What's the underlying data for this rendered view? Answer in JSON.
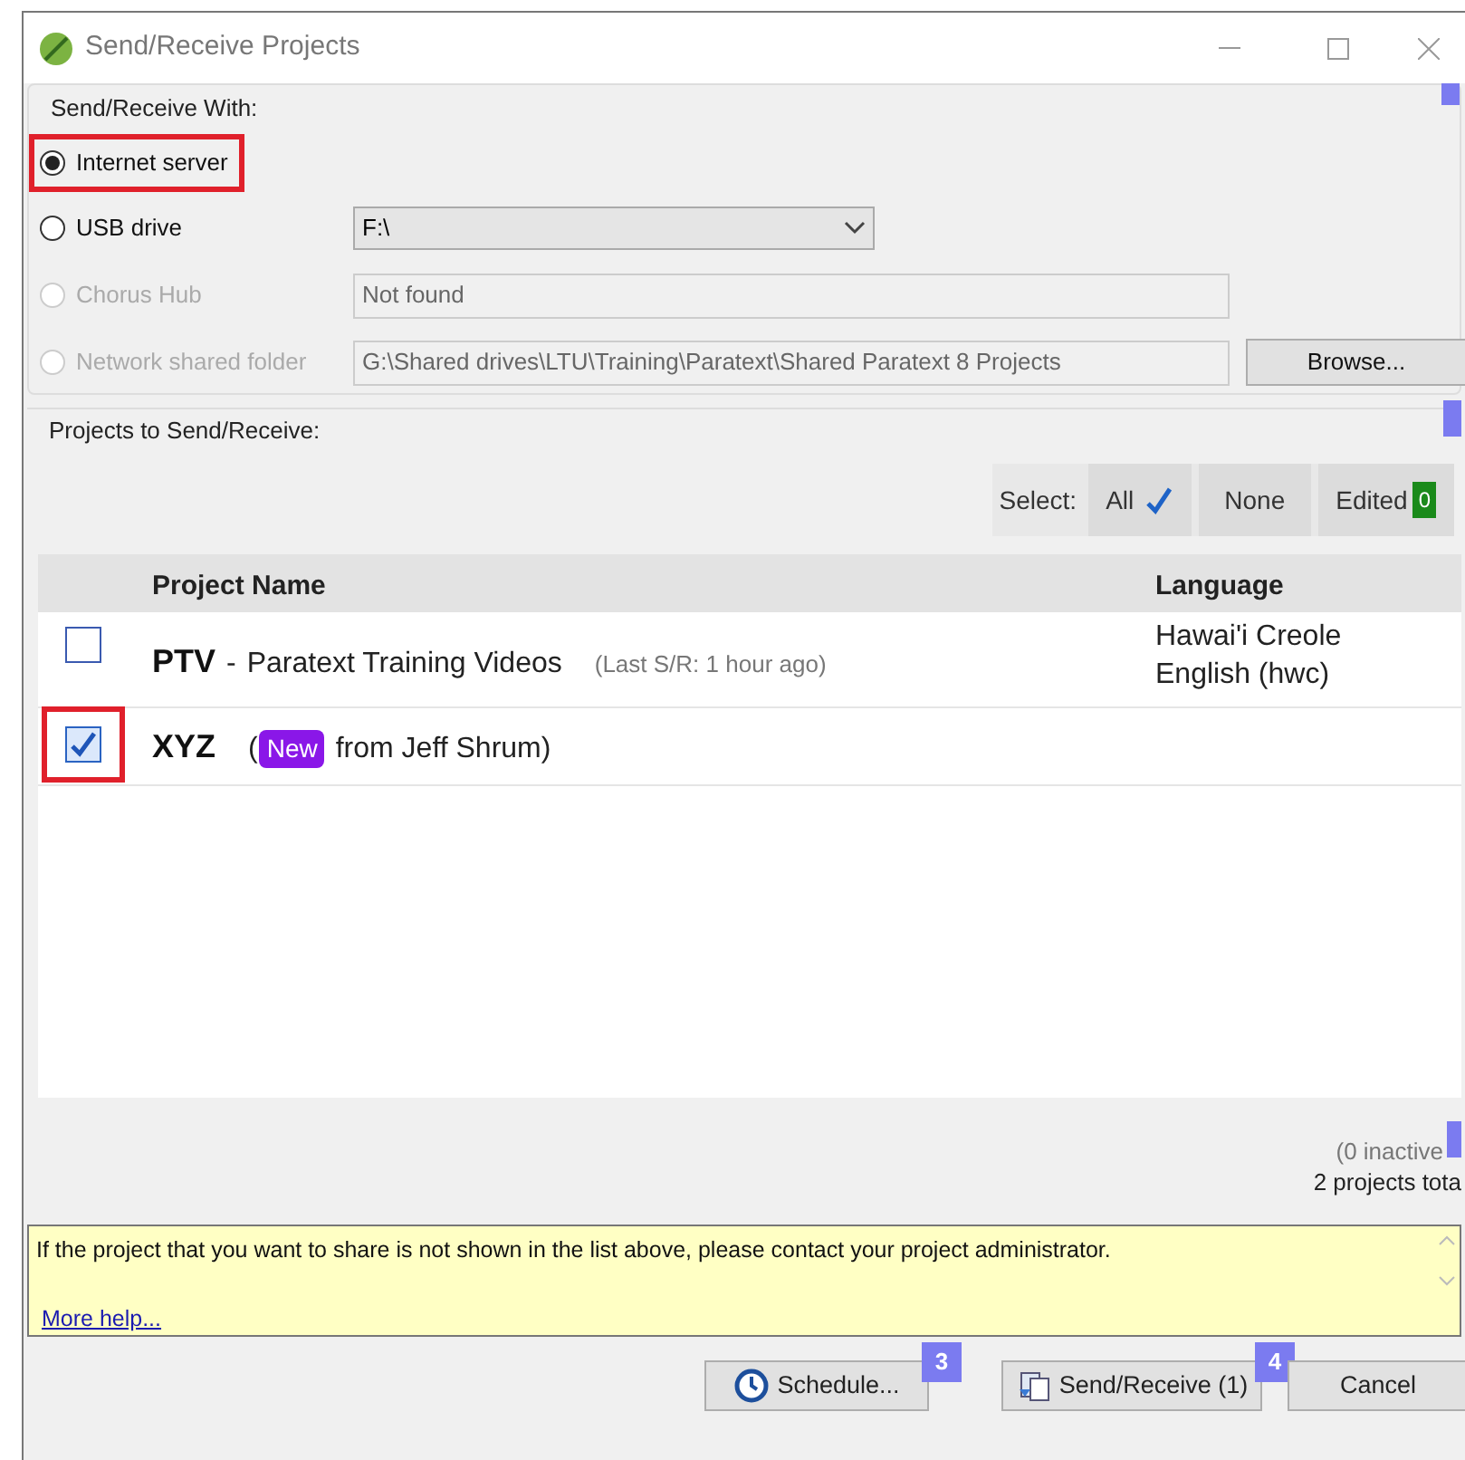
{
  "window": {
    "title": "Send/Receive Projects"
  },
  "send_receive_with": {
    "title": "Send/Receive With:",
    "options": [
      {
        "label": "Internet server",
        "selected": true,
        "disabled": false,
        "highlighted": true
      },
      {
        "label": "USB drive",
        "selected": false,
        "disabled": false,
        "highlighted": false,
        "kind": "dropdown",
        "value": "F:\\"
      },
      {
        "label": "Chorus Hub",
        "selected": false,
        "disabled": true,
        "highlighted": false,
        "kind": "field",
        "value": "Not found"
      },
      {
        "label": "Network shared folder",
        "selected": false,
        "disabled": true,
        "highlighted": false,
        "kind": "folder",
        "value": "G:\\Shared drives\\LTU\\Training\\Paratext\\Shared Paratext 8 Projects",
        "button": "Browse..."
      }
    ]
  },
  "projects": {
    "title": "Projects to Send/Receive:",
    "select_label": "Select:",
    "select_all": "All",
    "select_none": "None",
    "select_edited": "Edited",
    "edited_count": "0",
    "columns": [
      "Project Name",
      "Language"
    ],
    "rows": [
      {
        "checked": false,
        "highlighted": false,
        "code": "PTV",
        "separator": "-",
        "name": "Paratext Training Videos",
        "note": "(Last S/R: 1 hour ago)",
        "language": [
          "Hawai'i Creole",
          "English (hwc)"
        ]
      },
      {
        "checked": true,
        "highlighted": true,
        "code": "XYZ",
        "badge": "New",
        "from": "from Jeff Shrum)",
        "open": "("
      }
    ],
    "inactive": "(0 inactive",
    "total": "2 projects tota"
  },
  "help": {
    "text": "If the project that you want to share is not shown in the list above, please contact your project administrator.",
    "link": "More help..."
  },
  "buttons": [
    {
      "label": "Schedule...",
      "callout": "3",
      "kind": "schedule"
    },
    {
      "label": "Send/Receive (1)",
      "callout": "4",
      "kind": "sync"
    },
    {
      "label": "Cancel",
      "kind": "plain"
    }
  ]
}
